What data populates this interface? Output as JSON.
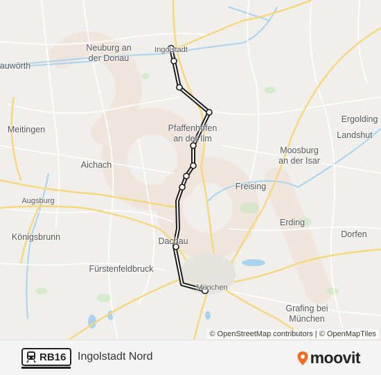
{
  "map": {
    "places": [
      {
        "name": "Neuburg an\nder Donau",
        "id": "neuburg"
      },
      {
        "name": "Ingolstadt",
        "id": "ingolstadt"
      },
      {
        "name": "auwörth",
        "id": "donauwoerth"
      },
      {
        "name": "Meitingen",
        "id": "meitingen"
      },
      {
        "name": "Pfaffenhofen\nan der Ilm",
        "id": "pfaffenhofen"
      },
      {
        "name": "Ergolding",
        "id": "ergolding"
      },
      {
        "name": "Landshut",
        "id": "landshut"
      },
      {
        "name": "Aichach",
        "id": "aichach"
      },
      {
        "name": "Moosburg\nan der Isar",
        "id": "moosburg"
      },
      {
        "name": "Freising",
        "id": "freising"
      },
      {
        "name": "Augsburg",
        "id": "augsburg"
      },
      {
        "name": "Erding",
        "id": "erding"
      },
      {
        "name": "Königsbrunn",
        "id": "koenigsbrunn"
      },
      {
        "name": "Dorfen",
        "id": "dorfen"
      },
      {
        "name": "Dachau",
        "id": "dachau"
      },
      {
        "name": "Fürstenfeldbruck",
        "id": "fuerstenfeldbruck"
      },
      {
        "name": "München",
        "id": "muenchen"
      },
      {
        "name": "Grafing bei\nMünchen",
        "id": "grafing"
      }
    ],
    "route_color": "#1a1a1a",
    "water_color": "#a8d4f0",
    "attribution": "© OpenStreetMap contributors | © OpenMapTiles"
  },
  "footer": {
    "route_code": "RB16",
    "destination": "Ingolstadt Nord",
    "brand": "moovit",
    "brand_color": "#f26b21",
    "train_icon": "train-icon"
  }
}
